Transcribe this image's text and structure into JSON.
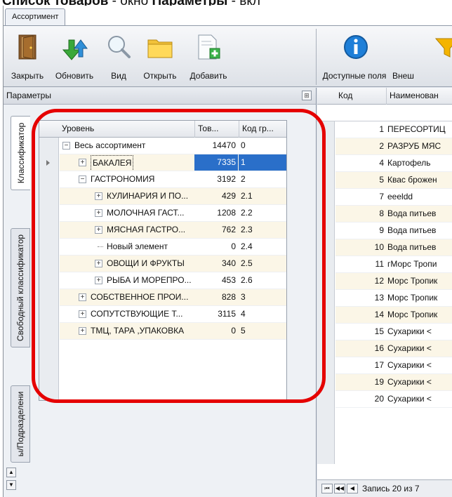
{
  "caption": {
    "part1": "Список товаров",
    "part2": " - окно ",
    "part3": "Параметры",
    "part4": " - вкл"
  },
  "doc_tab": "Ассортимент",
  "ribbon": {
    "close": "Закрыть",
    "refresh": "Обновить",
    "view": "Вид",
    "open": "Открыть",
    "add": "Добавить",
    "fields": "Доступные поля",
    "external": "Внеш"
  },
  "params_panel": {
    "title": "Параметры",
    "vtabs": [
      "Классификатор",
      "Свободный классификатор",
      "ы/Подразделени"
    ]
  },
  "tree": {
    "headers": {
      "level": "Уровень",
      "count": "Тов...",
      "code": "Код гр..."
    },
    "rows": [
      {
        "name": "Весь ассортимент",
        "count": "14470",
        "code": "0",
        "depth": 0,
        "toggle": "−"
      },
      {
        "name": "БАКАЛЕЯ",
        "count": "7335",
        "code": "1",
        "depth": 1,
        "toggle": "+",
        "selected": true
      },
      {
        "name": "ГАСТРОНОМИЯ",
        "count": "3192",
        "code": "2",
        "depth": 1,
        "toggle": "−"
      },
      {
        "name": "КУЛИНАРИЯ И ПО...",
        "count": "429",
        "code": "2.1",
        "depth": 2,
        "toggle": "+"
      },
      {
        "name": "МОЛОЧНАЯ ГАСТ...",
        "count": "1208",
        "code": "2.2",
        "depth": 2,
        "toggle": "+"
      },
      {
        "name": "МЯСНАЯ ГАСТРО...",
        "count": "762",
        "code": "2.3",
        "depth": 2,
        "toggle": "+"
      },
      {
        "name": "Новый элемент",
        "count": "0",
        "code": "2.4",
        "depth": 2,
        "toggle": ""
      },
      {
        "name": "ОВОЩИ И ФРУКТЫ",
        "count": "340",
        "code": "2.5",
        "depth": 2,
        "toggle": "+"
      },
      {
        "name": "РЫБА И МОРЕПРО...",
        "count": "453",
        "code": "2.6",
        "depth": 2,
        "toggle": "+"
      },
      {
        "name": "СОБСТВЕННОЕ ПРОИ...",
        "count": "828",
        "code": "3",
        "depth": 1,
        "toggle": "+"
      },
      {
        "name": "СОПУТСТВУЮЩИЕ Т...",
        "count": "3115",
        "code": "4",
        "depth": 1,
        "toggle": "+"
      },
      {
        "name": "ТМЦ, ТАРА ,УПАКОВКА",
        "count": "0",
        "code": "5",
        "depth": 1,
        "toggle": "+"
      }
    ]
  },
  "list": {
    "headers": {
      "code": "Код",
      "name": "Наименован"
    },
    "rows": [
      {
        "code": "1",
        "name": "ПЕРЕСОРТИЦ"
      },
      {
        "code": "2",
        "name": "РАЗРУБ МЯС"
      },
      {
        "code": "4",
        "name": "Картофель"
      },
      {
        "code": "5",
        "name": "Квас брожен"
      },
      {
        "code": "7",
        "name": "eeeldd"
      },
      {
        "code": "8",
        "name": "Вода питьев"
      },
      {
        "code": "9",
        "name": "Вода питьев"
      },
      {
        "code": "10",
        "name": "Вода питьев"
      },
      {
        "code": "11",
        "name": "гМорс Тропи"
      },
      {
        "code": "12",
        "name": "Морс Тропик"
      },
      {
        "code": "13",
        "name": "Морс Тропик"
      },
      {
        "code": "14",
        "name": "Морс Тропик"
      },
      {
        "code": "15",
        "name": "Сухарики <"
      },
      {
        "code": "16",
        "name": "Сухарики <"
      },
      {
        "code": "17",
        "name": "Сухарики <"
      },
      {
        "code": "19",
        "name": "Сухарики <"
      },
      {
        "code": "20",
        "name": "Сухарики <"
      }
    ],
    "status": "Запись 20 из 7"
  },
  "colors": {
    "highlight": "#e50000",
    "selection": "#2a6fc9",
    "alt_row": "#fbf6e7"
  }
}
